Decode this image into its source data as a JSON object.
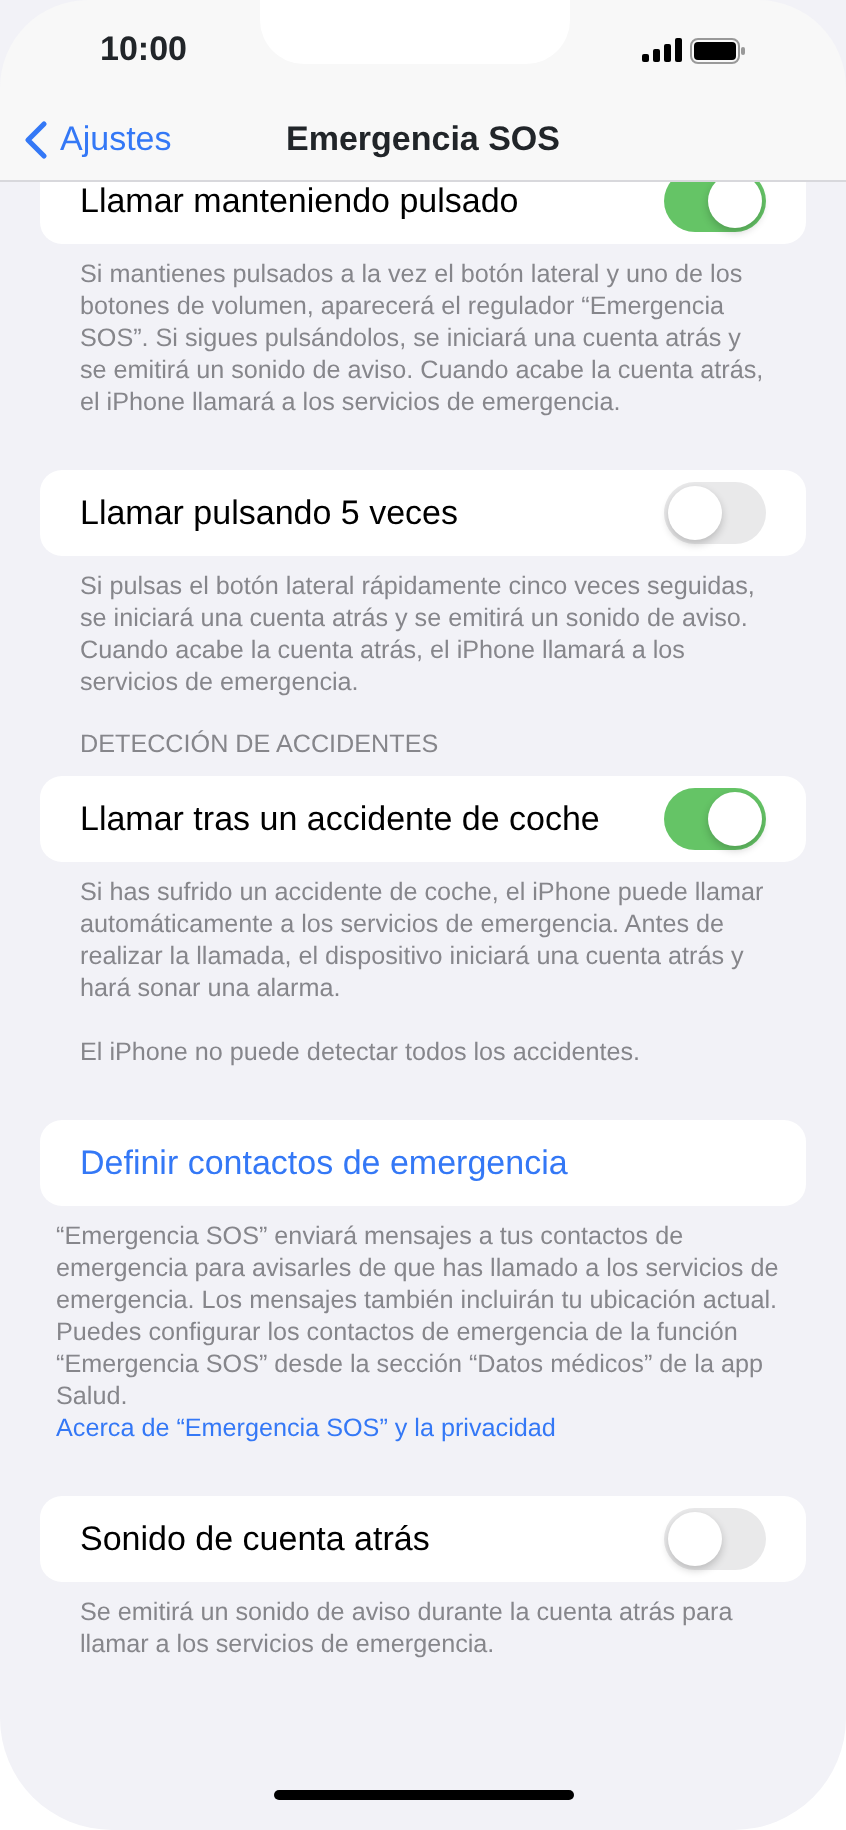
{
  "status_bar": {
    "time": "10:00"
  },
  "nav": {
    "back": "Ajustes",
    "title": "Emergencia SOS"
  },
  "sections": [
    {
      "clipped": true,
      "rows": [
        {
          "kind": "toggle",
          "label": "Llamar manteniendo pulsado",
          "on": true
        }
      ],
      "footer": [
        {
          "kind": "text",
          "text": "Si mantienes pulsados a la vez el botón lateral y uno de los botones de volumen, aparecerá el regulador “Emergencia SOS”. Si sigues pulsándolos, se iniciará una cuenta atrás y se emitirá un sonido de aviso. Cuando acabe la cuenta atrás, el iPhone llamará a los servicios de emergencia."
        }
      ]
    },
    {
      "rows": [
        {
          "kind": "toggle",
          "label": "Llamar pulsando 5 veces",
          "on": false
        }
      ],
      "footer": [
        {
          "kind": "text",
          "text": "Si pulsas el botón lateral rápidamente cinco veces seguidas, se iniciará una cuenta atrás y se emitirá un sonido de aviso. Cuando acabe la cuenta atrás, el iPhone llamará a los servicios de emergencia."
        }
      ]
    },
    {
      "header": "DETECCIÓN DE ACCIDENTES",
      "rows": [
        {
          "kind": "toggle",
          "label": "Llamar tras un accidente de coche",
          "on": true
        }
      ],
      "footer": [
        {
          "kind": "text",
          "text": "Si has sufrido un accidente de coche, el iPhone puede llamar automáticamente a los servicios de emergencia. Antes de realizar la llamada, el dispositivo iniciará una cuenta atrás y hará sonar una alarma."
        },
        {
          "kind": "text",
          "text": "El iPhone no puede detectar todos los accidentes."
        }
      ]
    },
    {
      "rows": [
        {
          "kind": "action",
          "label": "Definir contactos de emergencia"
        }
      ],
      "wide_footer": true,
      "footer": [
        {
          "kind": "text",
          "text": "“Emergencia SOS” enviará mensajes a tus contactos de emergencia para avisarles de que has llamado a los servicios de emergencia. Los mensajes también incluirán tu ubicación actual. Puedes configurar los contactos de emergencia de la función “Emergencia SOS” desde la sección “Datos médicos” de la app Salud."
        },
        {
          "kind": "link",
          "text": "Acerca de “Emergencia SOS” y la privacidad"
        }
      ]
    },
    {
      "rows": [
        {
          "kind": "toggle",
          "label": "Sonido de cuenta atrás",
          "on": false
        }
      ],
      "footer": [
        {
          "kind": "text",
          "text": "Se emitirá un sonido de aviso durante la cuenta atrás para llamar a los servicios de emergencia."
        }
      ]
    }
  ]
}
